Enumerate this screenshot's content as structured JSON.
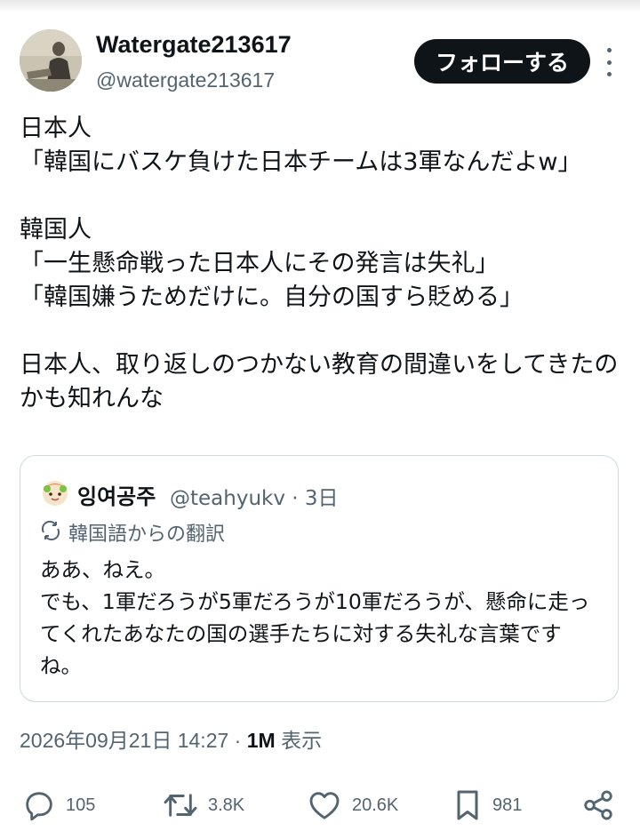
{
  "author": {
    "display_name": "Watergate213617",
    "handle": "@watergate213617",
    "follow_label": "フォローする"
  },
  "tweet": {
    "text": "日本人\n「韓国にバスケ負けた日本チームは3軍なんだよw」\n\n韓国人\n「一生懸命戦った日本人にその発言は失礼」\n「韓国嫌うためだけに。自分の国すら貶める」\n\n日本人、取り返しのつかない教育の間違いをしてきたのかも知れんな"
  },
  "quoted_tweet": {
    "display_name": "잉여공주",
    "handle": "@teahyukv",
    "separator": "·",
    "age": "3日",
    "translation_note": "韓国語からの翻訳",
    "text": "ああ、ねえ。\nでも、1軍だろうが5軍だろうが10軍だろうが、懸命に走ってくれたあなたの国の選手たちに対する失礼な言葉ですね。"
  },
  "meta": {
    "datetime": "2026年09月21日 14:27",
    "dot": "·",
    "views_count": "1M",
    "views_label": "表示"
  },
  "actions": {
    "replies": "105",
    "reposts": "3.8K",
    "likes": "20.6K",
    "bookmarks": "981"
  },
  "icons": {
    "more": "more-vertical-icon",
    "translate": "translate-icon",
    "reply": "reply-icon",
    "repost": "repost-icon",
    "like": "heart-icon",
    "bookmark": "bookmark-icon",
    "share": "share-icon"
  },
  "colors": {
    "text": "#0f1419",
    "secondary": "#536471",
    "border": "#cfd9de",
    "follow_bg": "#0f1419"
  }
}
